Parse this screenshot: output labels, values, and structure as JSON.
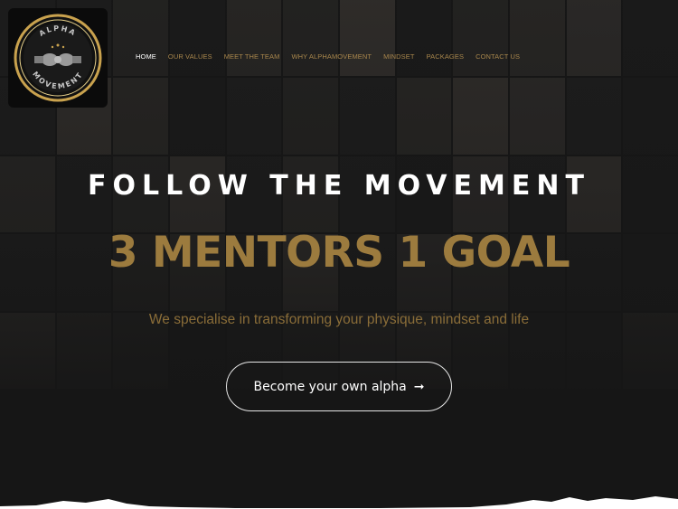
{
  "brand": {
    "logo_top_text": "ALPHA",
    "logo_bottom_text": "MOVEMENT"
  },
  "nav": {
    "items": [
      {
        "label": "HOME",
        "active": true
      },
      {
        "label": "OUR VALUES",
        "active": false
      },
      {
        "label": "MEET THE TEAM",
        "active": false
      },
      {
        "label": "WHY ALPHAMOVEMENT",
        "active": false
      },
      {
        "label": "MINDSET",
        "active": false
      },
      {
        "label": "PACKAGES",
        "active": false
      },
      {
        "label": "CONTACT US",
        "active": false
      }
    ]
  },
  "hero": {
    "headline": "FOLLOW THE MOVEMENT",
    "subheadline": "3 MENTORS 1 GOAL",
    "tagline": "We specialise in transforming your physique, mindset and life",
    "cta_label": "Become your own alpha",
    "cta_icon": "arrow-right-icon"
  },
  "colors": {
    "background": "#161616",
    "gold": "#9c7b3e",
    "nav_text": "#a8864c",
    "white": "#ffffff"
  }
}
